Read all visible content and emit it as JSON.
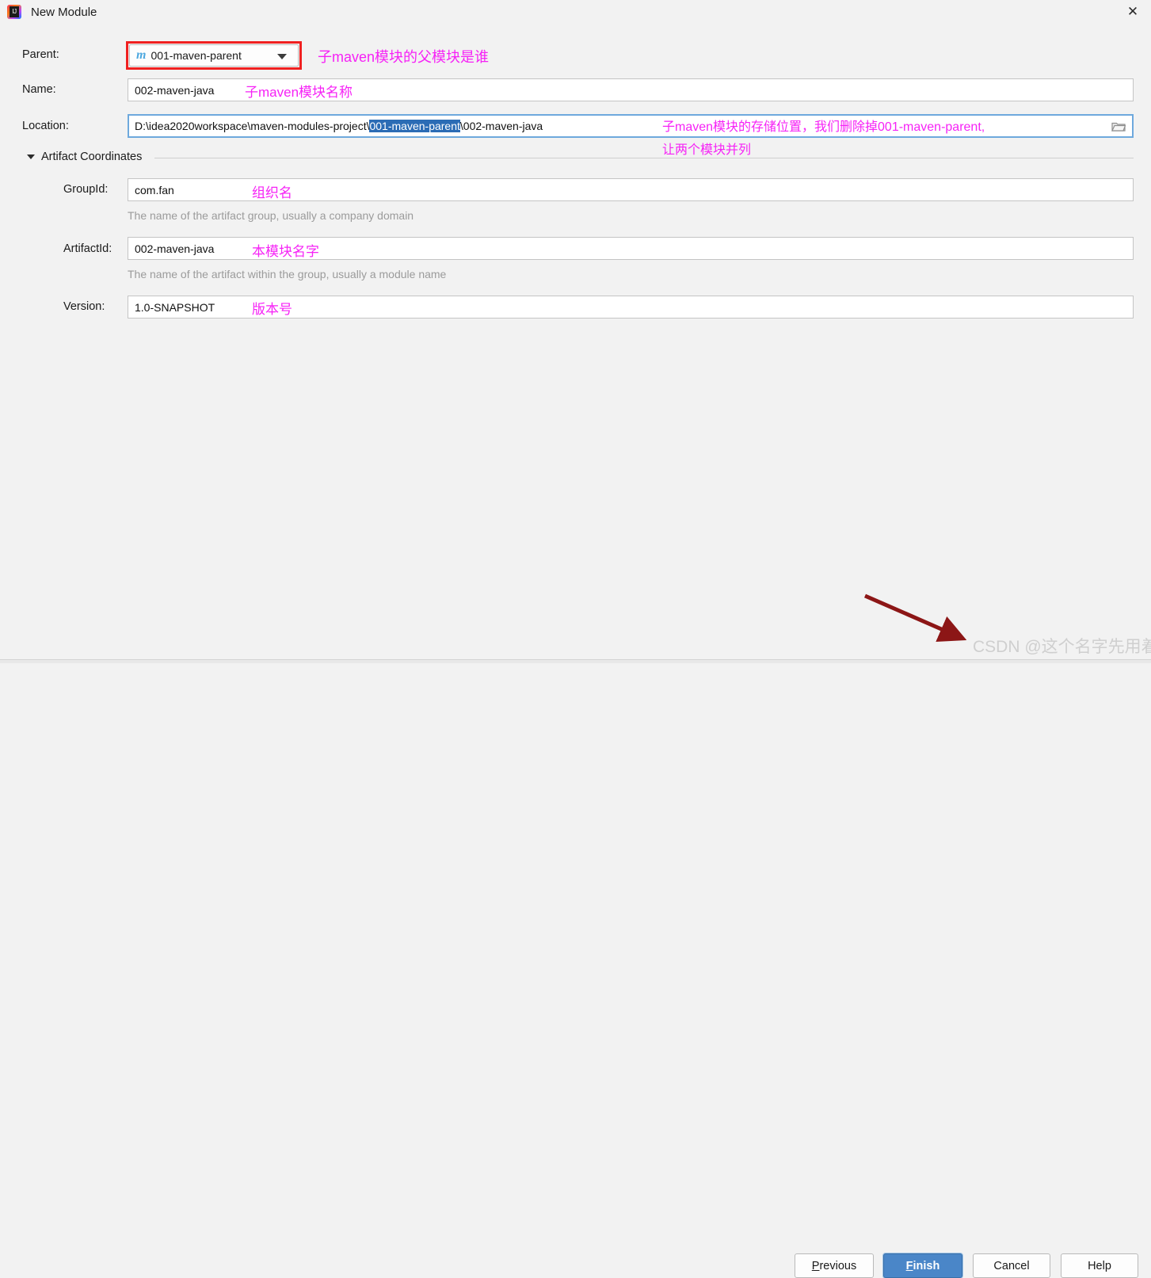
{
  "window": {
    "title": "New Module",
    "icon": "intellij-idea-icon",
    "close_label": "✕"
  },
  "form": {
    "parent": {
      "label": "Parent:",
      "value": "001-maven-parent",
      "icon": "maven-m-icon",
      "annotation": "子maven模块的父模块是谁",
      "highlight_color": "#f02020"
    },
    "name": {
      "label": "Name:",
      "value": "002-maven-java",
      "annotation": "子maven模块名称"
    },
    "location": {
      "label": "Location:",
      "value_prefix": "D:\\idea2020workspace\\maven-modules-project\\",
      "value_selected": "001-maven-parent",
      "value_suffix": "\\002-maven-java",
      "selection_color": "#2b6cb5",
      "browse_icon": "folder-icon",
      "annotation_line1": "子maven模块的存储位置，我们删除掉001-maven-parent,",
      "annotation_line2": "让两个模块并列"
    },
    "artifact_coordinates": {
      "section_title": "Artifact Coordinates",
      "expanded": true,
      "group_id": {
        "label": "GroupId:",
        "value": "com.fan",
        "hint": "The name of the artifact group, usually a company domain",
        "annotation": "组织名"
      },
      "artifact_id": {
        "label": "ArtifactId:",
        "value": "002-maven-java",
        "hint": "The name of the artifact within the group, usually a module name",
        "annotation": "本模块名字"
      },
      "version": {
        "label": "Version:",
        "value": "1.0-SNAPSHOT",
        "annotation": "版本号"
      }
    }
  },
  "buttons": {
    "previous": {
      "mnemonic": "P",
      "rest": "revious"
    },
    "finish": {
      "mnemonic": "F",
      "rest": "inish",
      "primary": true,
      "accent_color": "#4a86c8"
    },
    "cancel": {
      "label": "Cancel"
    },
    "help": {
      "label": "Help"
    }
  },
  "annotations": {
    "arrow_color": "#8c1616"
  },
  "watermark": "CSDN @这个名字先用着"
}
